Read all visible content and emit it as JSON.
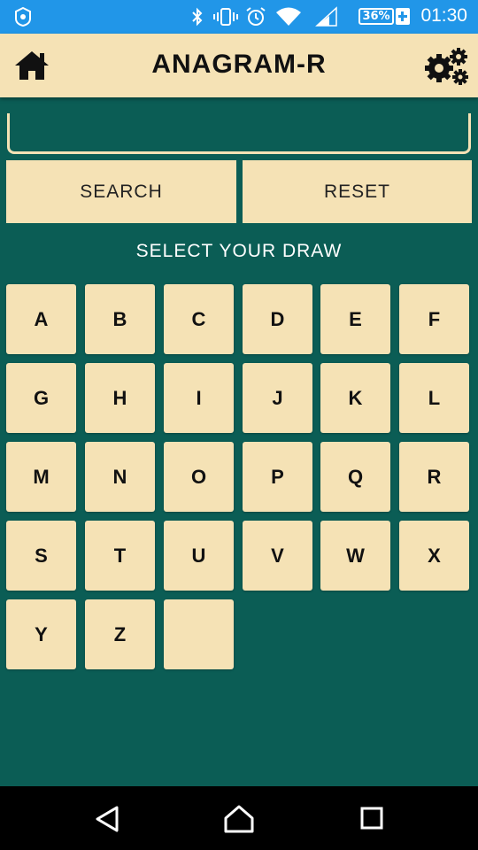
{
  "status_bar": {
    "battery_percent": "36%",
    "time": "01:30",
    "icons": [
      "app-badge-icon",
      "bluetooth-icon",
      "vibrate-icon",
      "alarm-icon",
      "wifi-icon",
      "signal-icon",
      "battery-charging-icon"
    ]
  },
  "header": {
    "title": "ANAGRAM-R",
    "home_icon": "home-icon",
    "settings_icon": "gears-icon"
  },
  "input": {
    "value": "",
    "placeholder": ""
  },
  "buttons": {
    "search": "SEARCH",
    "reset": "RESET"
  },
  "section_label": "SELECT YOUR DRAW",
  "letters": [
    "A",
    "B",
    "C",
    "D",
    "E",
    "F",
    "G",
    "H",
    "I",
    "J",
    "K",
    "L",
    "M",
    "N",
    "O",
    "P",
    "Q",
    "R",
    "S",
    "T",
    "U",
    "V",
    "W",
    "X",
    "Y",
    "Z",
    ""
  ],
  "nav": {
    "back_icon": "back-triangle-icon",
    "home_icon": "home-circle-icon",
    "recents_icon": "recents-square-icon"
  },
  "colors": {
    "background": "#0b5d55",
    "tile": "#f5e2b5",
    "status_bar": "#2196e8",
    "text": "#111111"
  }
}
